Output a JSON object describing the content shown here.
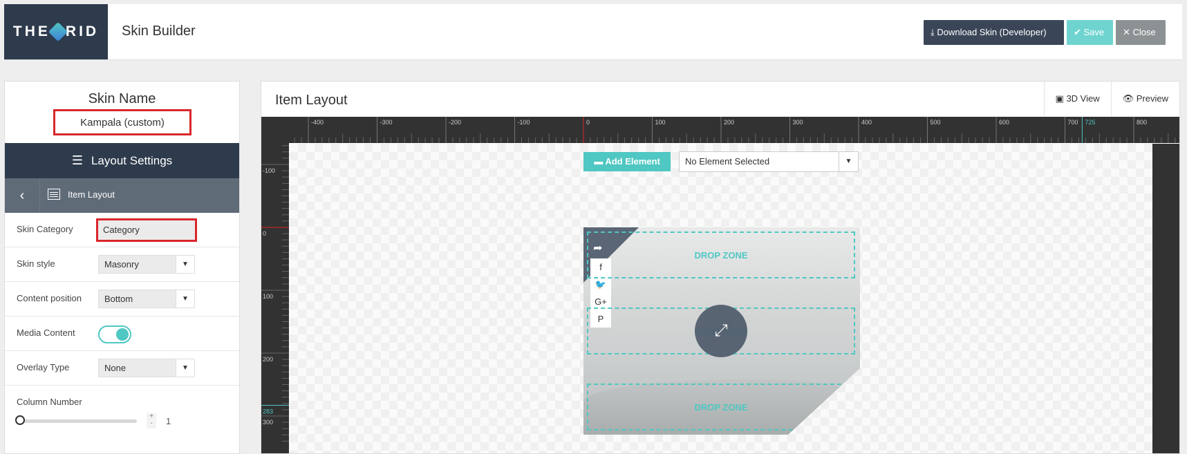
{
  "header": {
    "logo_text_left": "THE",
    "logo_text_right": "RID",
    "app_title": "Skin Builder",
    "download_label": "Download Skin (Developer)",
    "save_label": "Save",
    "close_label": "Close"
  },
  "left_panel": {
    "skin_name_label": "Skin Name",
    "skin_name_value": "Kampala (custom)",
    "layout_settings_label": "Layout Settings",
    "item_layout_label": "Item Layout",
    "fields": {
      "skin_category_label": "Skin Category",
      "skin_category_value": "Category",
      "skin_style_label": "Skin style",
      "skin_style_value": "Masonry",
      "content_position_label": "Content position",
      "content_position_value": "Bottom",
      "media_content_label": "Media Content",
      "media_content_on": true,
      "overlay_type_label": "Overlay Type",
      "overlay_type_value": "None",
      "column_number_label": "Column Number",
      "column_number_value": "1",
      "stepper_plus": "+",
      "stepper_minus": "-"
    }
  },
  "right_panel": {
    "title": "Item Layout",
    "tool_3d": "3D View",
    "tool_preview": "Preview",
    "ruler_h_labels": [
      "-400",
      "-300",
      "-200",
      "-100",
      "0",
      "100",
      "200",
      "300",
      "400",
      "500",
      "600",
      "700",
      "725",
      "800"
    ],
    "ruler_v_labels": [
      "-100",
      "0",
      "100",
      "200",
      "283",
      "300"
    ],
    "add_element_label": "Add Element",
    "element_select_value": "No Element Selected",
    "drop_zone_label": "DROP ZONE"
  },
  "colors": {
    "accent": "#4fc7c2",
    "dark": "#2e3b4c",
    "highlight": "#d9262b"
  }
}
